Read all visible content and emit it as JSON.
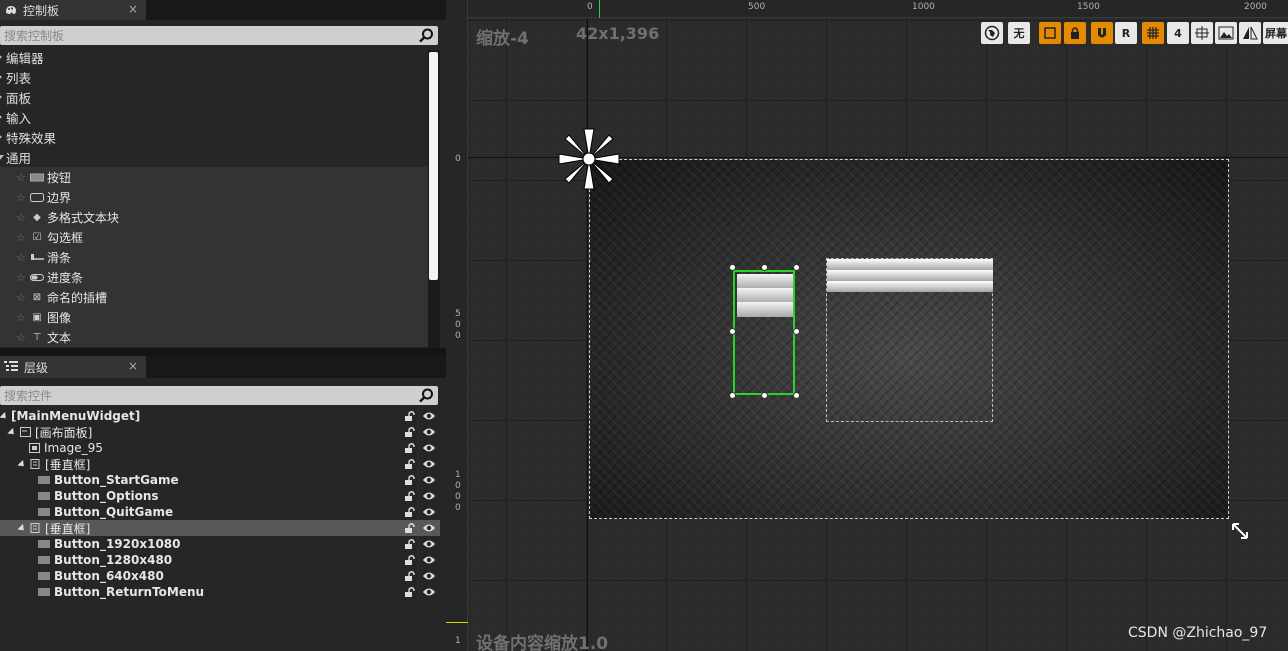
{
  "palette": {
    "tab_title": "控制板",
    "close_glyph": "×",
    "search_placeholder": "搜索控制板",
    "categories": [
      "编辑器",
      "列表",
      "面板",
      "输入",
      "特殊效果",
      "通用"
    ],
    "items": [
      {
        "label": "按钮",
        "icon": "button-widget-icon"
      },
      {
        "label": "边界",
        "icon": "border-widget-icon"
      },
      {
        "label": "多格式文本块",
        "icon": "rich-text-icon"
      },
      {
        "label": "勾选框",
        "icon": "checkbox-icon"
      },
      {
        "label": "滑条",
        "icon": "slider-icon"
      },
      {
        "label": "进度条",
        "icon": "progress-bar-icon"
      },
      {
        "label": "命名的插槽",
        "icon": "named-slot-icon"
      },
      {
        "label": "图像",
        "icon": "image-icon"
      },
      {
        "label": "文本",
        "icon": "text-icon"
      }
    ]
  },
  "hierarchy": {
    "tab_title": "层级",
    "close_glyph": "×",
    "search_placeholder": "搜索控件",
    "rows": [
      {
        "label": "[MainMenuWidget]",
        "bold": true
      },
      {
        "label": "[画布面板]",
        "bold": false
      },
      {
        "label": "Image_95",
        "bold": false
      },
      {
        "label": "[垂直框]",
        "bold": false
      },
      {
        "label": "Button_StartGame",
        "bold": true
      },
      {
        "label": "Button_Options",
        "bold": true
      },
      {
        "label": "Button_QuitGame",
        "bold": true
      },
      {
        "label": "[垂直框]",
        "bold": false
      },
      {
        "label": "Button_1920x1080",
        "bold": true
      },
      {
        "label": "Button_1280x480",
        "bold": true
      },
      {
        "label": "Button_640x480",
        "bold": true
      },
      {
        "label": "Button_ReturnToMenu",
        "bold": true
      }
    ],
    "selected_row": 7
  },
  "viewport": {
    "zoom_label": "缩放-4",
    "size_label": "42x1,396",
    "device_scale_label": "设备内容缩放1.0",
    "ruler_top": [
      "0",
      "500",
      "1000",
      "1500",
      "2000"
    ],
    "ruler_left": [
      "0",
      "5\n0\n0",
      "1\n0\n0\n0",
      "1"
    ],
    "toolbar": {
      "none_label": "无",
      "r_label": "R",
      "grid_value": "4",
      "screen_label": "屏幕"
    },
    "watermark": "CSDN @Zhichao_97"
  },
  "colors": {
    "accent_orange": "#e38a00",
    "selection_green": "#28d428"
  }
}
